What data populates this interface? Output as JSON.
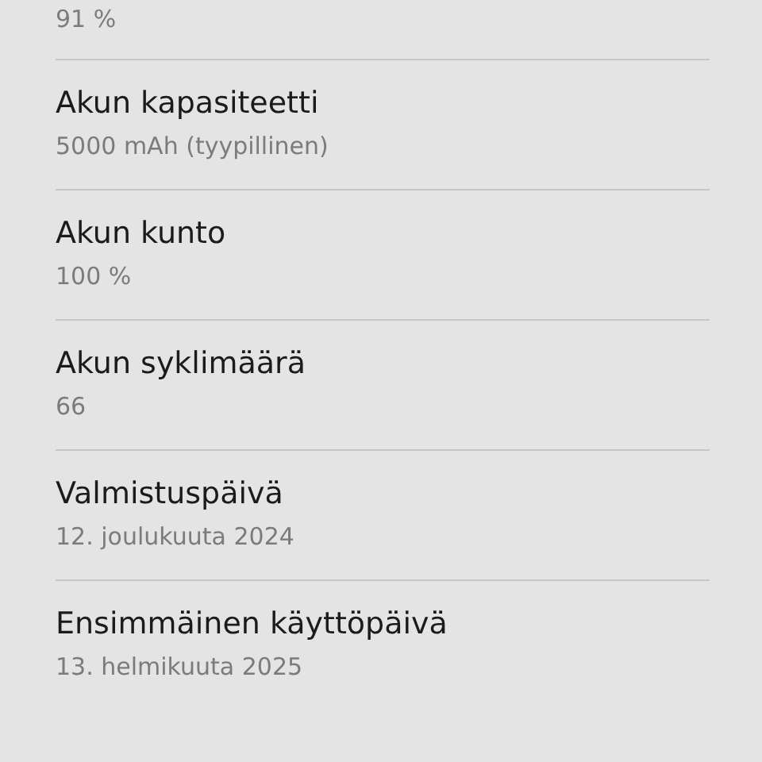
{
  "previous_item": {
    "value": "91 %"
  },
  "items": [
    {
      "title": "Akun kapasiteetti",
      "value": "5000 mAh (tyypillinen)"
    },
    {
      "title": "Akun kunto",
      "value": "100 %"
    },
    {
      "title": "Akun syklimäärä",
      "value": "66"
    },
    {
      "title": "Valmistuspäivä",
      "value": "12. joulukuuta 2024"
    },
    {
      "title": "Ensimmäinen käyttöpäivä",
      "value": "13. helmikuuta 2025"
    }
  ]
}
